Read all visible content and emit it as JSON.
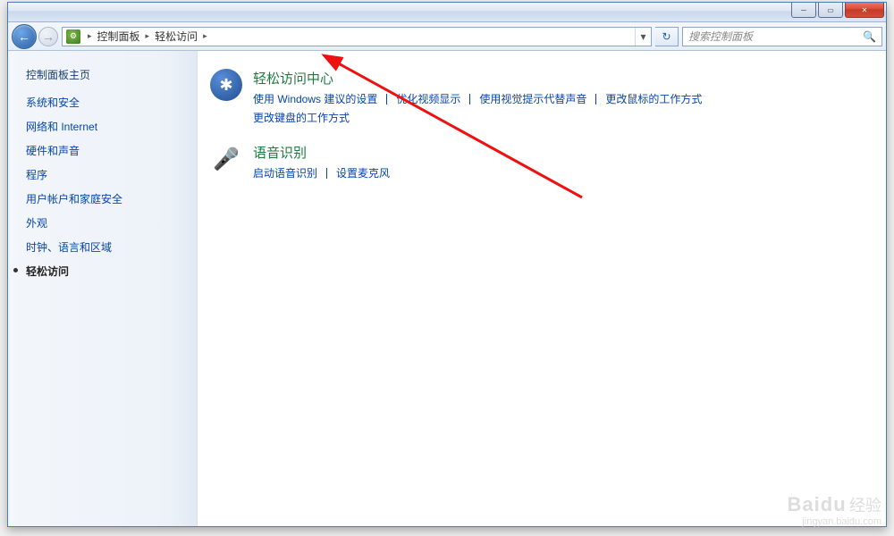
{
  "window_controls": {
    "minimize_glyph": "─",
    "maximize_glyph": "▭",
    "close_glyph": "✕"
  },
  "nav": {
    "back_glyph": "←",
    "forward_glyph": "→",
    "refresh_glyph": "↻"
  },
  "address": {
    "icon_glyph": "⚙",
    "crumbs": [
      "控制面板",
      "轻松访问"
    ],
    "separator": "▸",
    "dropdown_glyph": "▾"
  },
  "search": {
    "placeholder": "搜索控制面板",
    "icon_glyph": "🔍"
  },
  "sidebar": {
    "title": "控制面板主页",
    "items": [
      {
        "label": "系统和安全",
        "active": false
      },
      {
        "label": "网络和 Internet",
        "active": false
      },
      {
        "label": "硬件和声音",
        "active": false
      },
      {
        "label": "程序",
        "active": false
      },
      {
        "label": "用户帐户和家庭安全",
        "active": false
      },
      {
        "label": "外观",
        "active": false
      },
      {
        "label": "时钟、语言和区域",
        "active": false
      },
      {
        "label": "轻松访问",
        "active": true
      }
    ]
  },
  "categories": [
    {
      "icon": "ease",
      "icon_glyph": "✱",
      "title": "轻松访问中心",
      "links": [
        "使用 Windows 建议的设置",
        "优化视频显示",
        "使用视觉提示代替声音",
        "更改鼠标的工作方式",
        "更改键盘的工作方式"
      ]
    },
    {
      "icon": "speech",
      "icon_glyph": "🎤",
      "title": "语音识别",
      "links": [
        "启动语音识别",
        "设置麦克风"
      ]
    }
  ],
  "watermark": {
    "brand": "Baidu",
    "brand_cn": "经验",
    "url": "jingyan.baidu.com"
  }
}
